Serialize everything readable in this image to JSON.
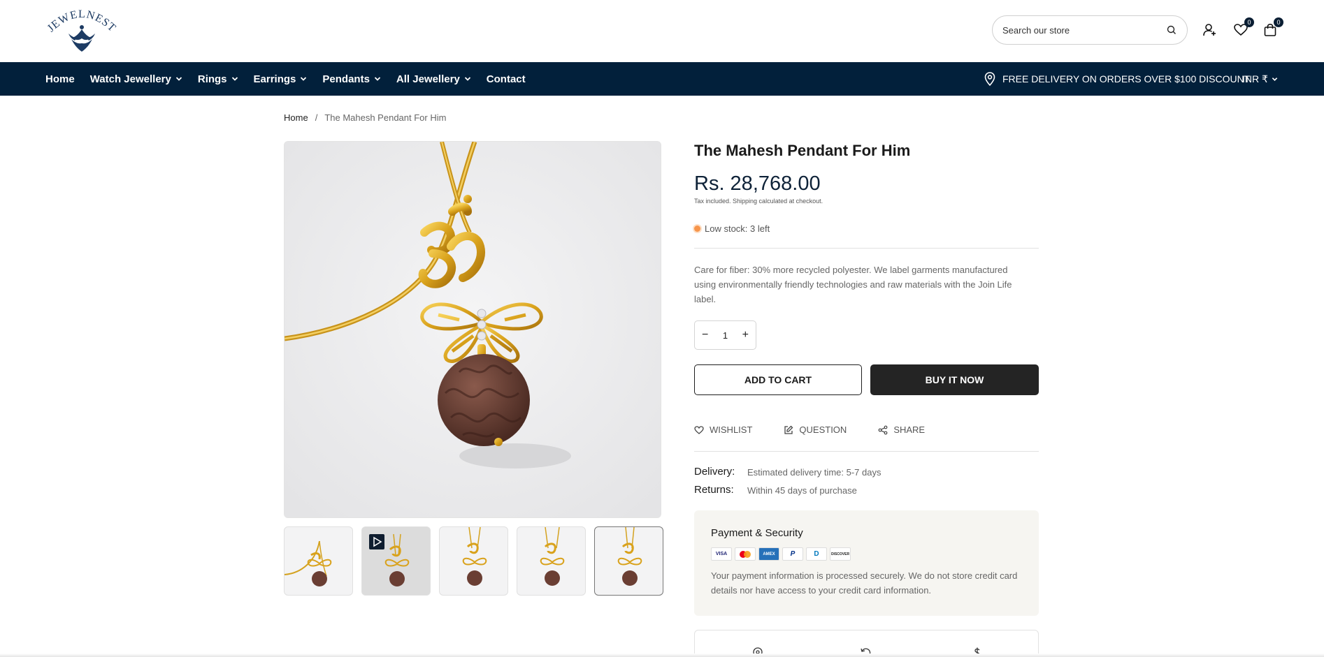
{
  "header": {
    "logo_text": "JEWELNEST",
    "search_placeholder": "Search our store",
    "wishlist_count": "0",
    "cart_count": "0"
  },
  "nav": {
    "items": [
      {
        "label": "Home",
        "has_dropdown": false
      },
      {
        "label": "Watch Jewellery",
        "has_dropdown": true
      },
      {
        "label": "Rings",
        "has_dropdown": true
      },
      {
        "label": "Earrings",
        "has_dropdown": true
      },
      {
        "label": "Pendants",
        "has_dropdown": true
      },
      {
        "label": "All Jewellery",
        "has_dropdown": true
      },
      {
        "label": "Contact",
        "has_dropdown": false
      }
    ],
    "promo": "FREE DELIVERY ON ORDERS OVER $100 DISCOUNT.",
    "currency": "INR ₹"
  },
  "breadcrumb": {
    "home": "Home",
    "separator": "/",
    "current": "The Mahesh Pendant For Him"
  },
  "product": {
    "title": "The Mahesh Pendant For Him",
    "price": "Rs. 28,768.00",
    "tax_note": "Tax included. Shipping calculated at checkout.",
    "stock": "Low stock: 3 left",
    "description": "Care for fiber: 30% more recycled polyester. We label garments manufactured using environmentally friendly technologies and raw materials with the Join Life label.",
    "quantity": "1",
    "add_to_cart": "ADD TO CART",
    "buy_now": "BUY IT NOW",
    "actions": {
      "wishlist": "WISHLIST",
      "question": "QUESTION",
      "share": "SHARE"
    },
    "delivery_label": "Delivery:",
    "delivery_value": "Estimated delivery time: 5-7 days",
    "returns_label": "Returns:",
    "returns_value": "Within 45 days of purchase"
  },
  "payment": {
    "title": "Payment & Security",
    "cards": [
      "VISA",
      "MC",
      "AMEX",
      "P",
      "D",
      "DISCOVER"
    ],
    "text": "Your payment information is processed securely. We do not store credit card details nor have access to your credit card information."
  },
  "colors": {
    "nav_bg": "#02203b",
    "price": "#0e2238",
    "stock_dot": "#f7954b",
    "buy_now_bg": "#242424"
  }
}
